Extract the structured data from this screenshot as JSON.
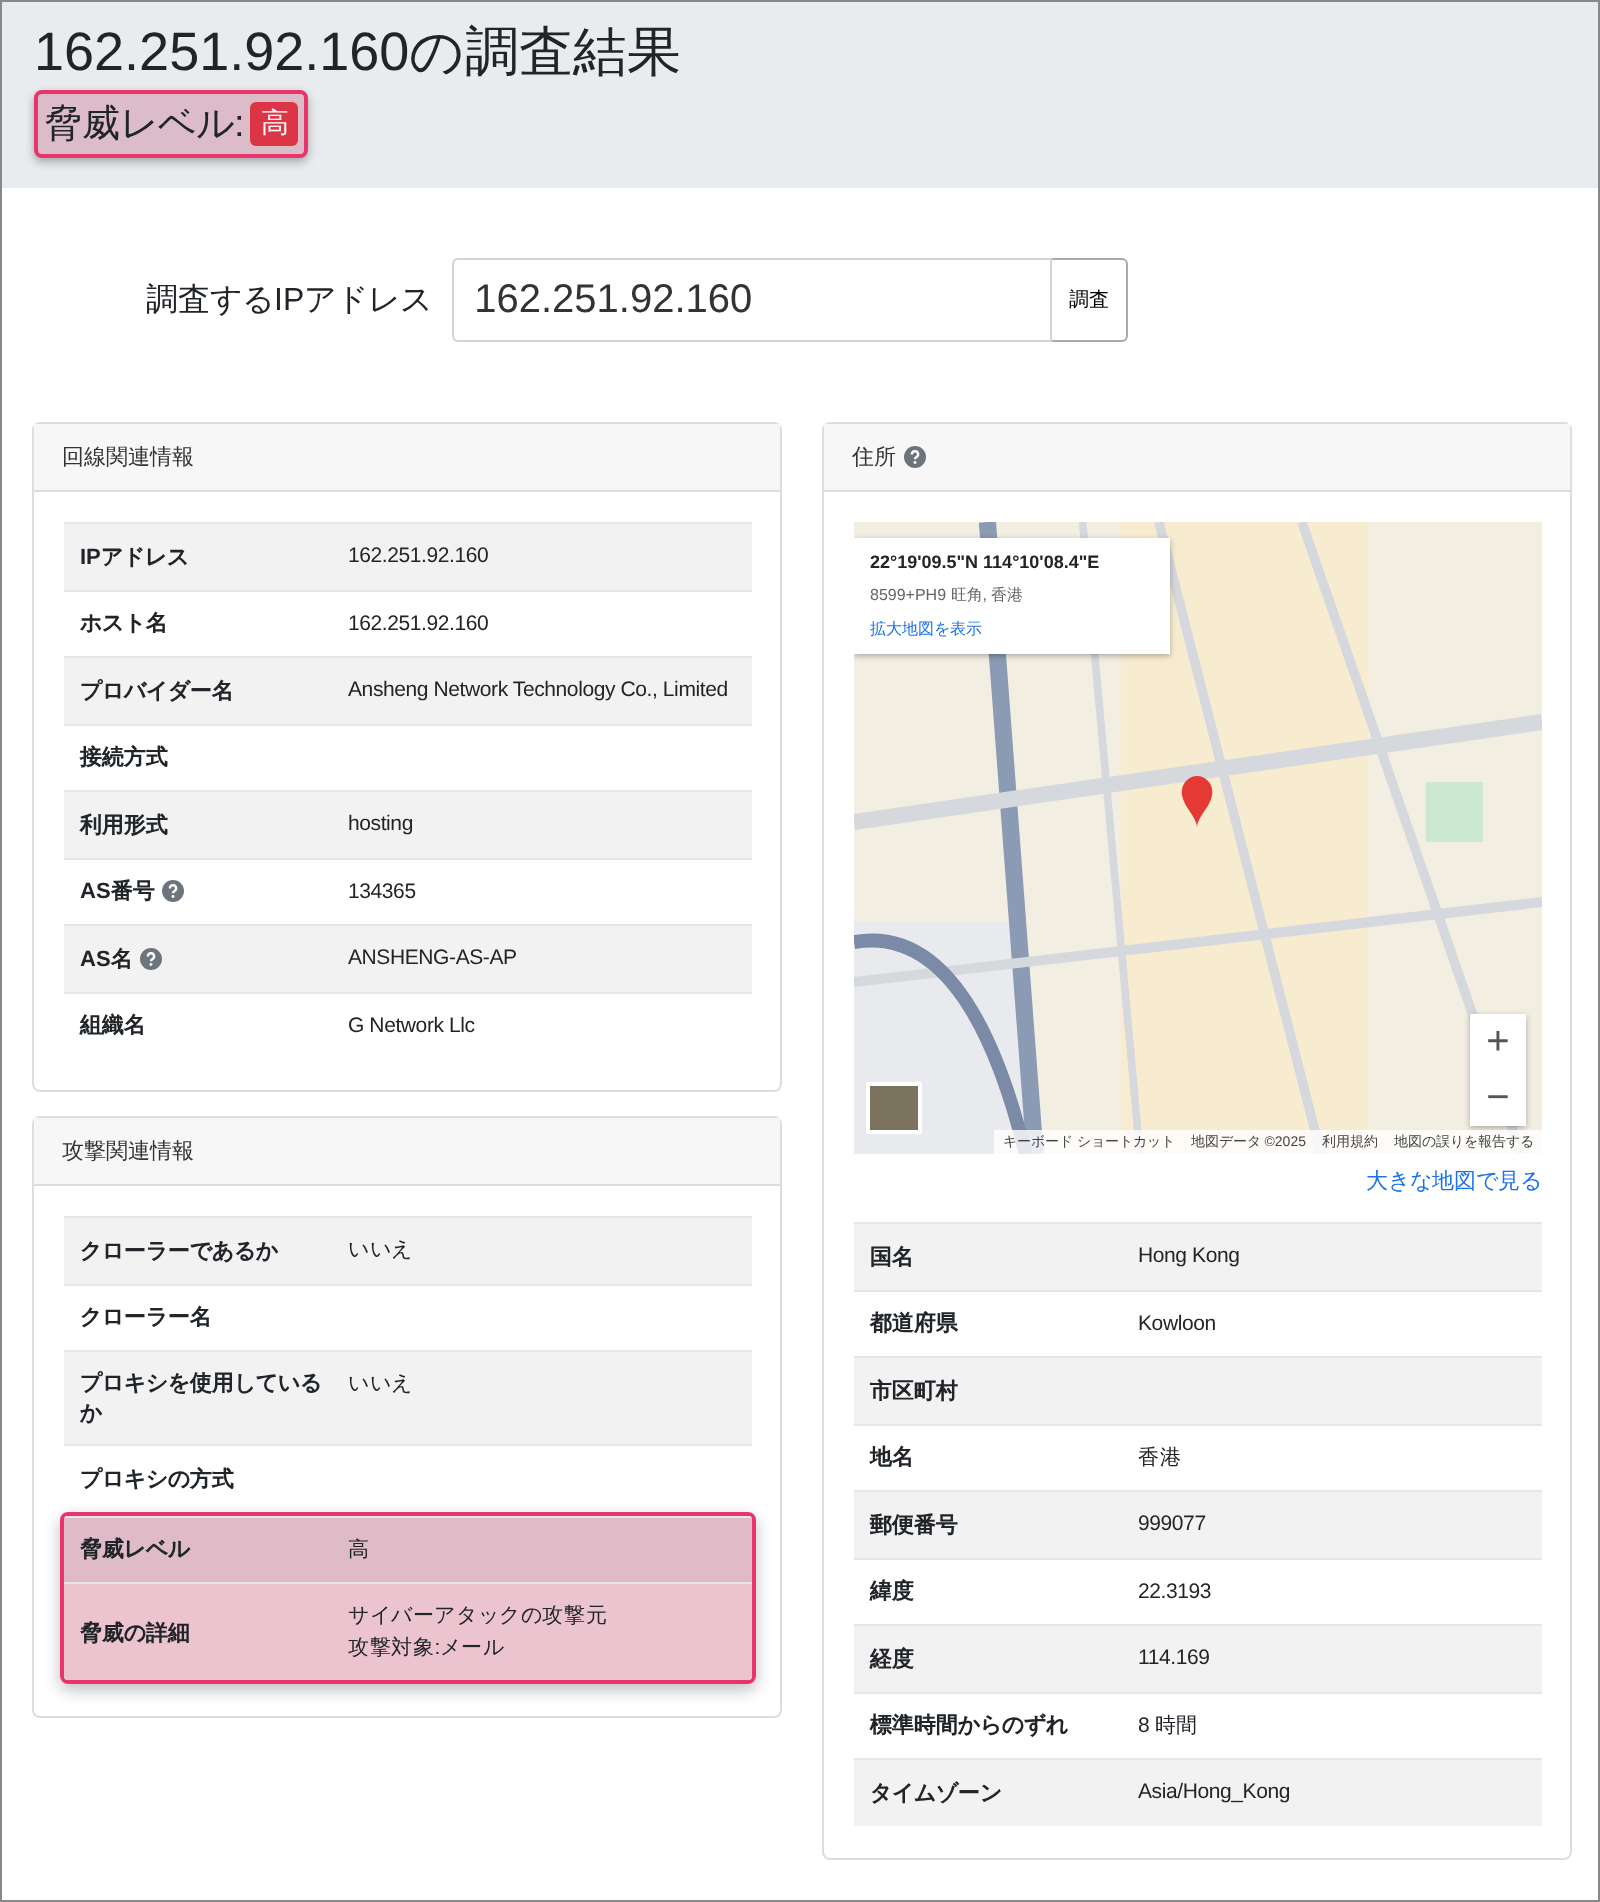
{
  "header": {
    "title": "162.251.92.160の調査結果",
    "threat": {
      "label": "脅威レベル:",
      "badge": "高",
      "highlighted": true
    }
  },
  "search": {
    "label": "調査するIPアドレス",
    "value": "162.251.92.160",
    "button": "調査"
  },
  "line_info": {
    "title": "回線関連情報",
    "rows": [
      {
        "label": "IPアドレス",
        "value": "162.251.92.160",
        "help": false,
        "highlighted": false
      },
      {
        "label": "ホスト名",
        "value": "162.251.92.160",
        "help": false,
        "highlighted": false
      },
      {
        "label": "プロバイダー名",
        "value": "Ansheng Network Technology Co., Limited",
        "help": false,
        "highlighted": false
      },
      {
        "label": "接続方式",
        "value": "",
        "help": false,
        "highlighted": false
      },
      {
        "label": "利用形式",
        "value": "hosting",
        "help": false,
        "highlighted": false
      },
      {
        "label": "AS番号",
        "value": "134365",
        "help": true,
        "highlighted": false
      },
      {
        "label": "AS名",
        "value": "ANSHENG-AS-AP",
        "help": true,
        "highlighted": false
      },
      {
        "label": "組織名",
        "value": "G Network Llc",
        "help": false,
        "highlighted": false
      }
    ]
  },
  "attack_info": {
    "title": "攻撃関連情報",
    "rows": [
      {
        "label": "クローラーであるか",
        "value": "いいえ",
        "help": false,
        "highlighted": false
      },
      {
        "label": "クローラー名",
        "value": "",
        "help": false,
        "highlighted": false
      },
      {
        "label": "プロキシを使用しているか",
        "value": "いいえ",
        "help": false,
        "highlighted": false
      },
      {
        "label": "プロキシの方式",
        "value": "",
        "help": false,
        "highlighted": false
      },
      {
        "label": "脅威レベル",
        "value": "高",
        "help": false,
        "highlighted": true
      },
      {
        "label": "脅威の詳細",
        "value": "サイバーアタックの攻撃元",
        "value_2": "攻撃対象:メール",
        "help": false,
        "highlighted": true
      }
    ]
  },
  "address": {
    "title": "住所",
    "help": true,
    "map": {
      "coords": "22°19'09.5\"N 114°10'08.4\"E",
      "plus_code": "8599+PH9 旺角, 香港",
      "enlarge_link": "拡大地図を表示",
      "zoom_in": "+",
      "zoom_out": "−",
      "footer": [
        "キーボード ショートカット",
        "地図データ ©2025",
        "利用規約",
        "地図の誤りを報告する"
      ]
    },
    "big_map_link": "大きな地図で見る",
    "rows": [
      {
        "label": "国名",
        "value": "Hong Kong",
        "help": false,
        "highlighted": false
      },
      {
        "label": "都道府県",
        "value": "Kowloon",
        "help": false,
        "highlighted": false
      },
      {
        "label": "市区町村",
        "value": "",
        "help": false,
        "highlighted": false
      },
      {
        "label": "地名",
        "value": "香港",
        "help": false,
        "highlighted": false
      },
      {
        "label": "郵便番号",
        "value": "999077",
        "help": false,
        "highlighted": false
      },
      {
        "label": "緯度",
        "value": "22.3193",
        "help": false,
        "highlighted": false
      },
      {
        "label": "経度",
        "value": "114.169",
        "help": false,
        "highlighted": false
      },
      {
        "label": "標準時間からのずれ",
        "value": "8 時間",
        "help": false,
        "highlighted": false
      },
      {
        "label": "タイムゾーン",
        "value": "Asia/Hong_Kong",
        "help": false,
        "highlighted": false
      }
    ]
  }
}
